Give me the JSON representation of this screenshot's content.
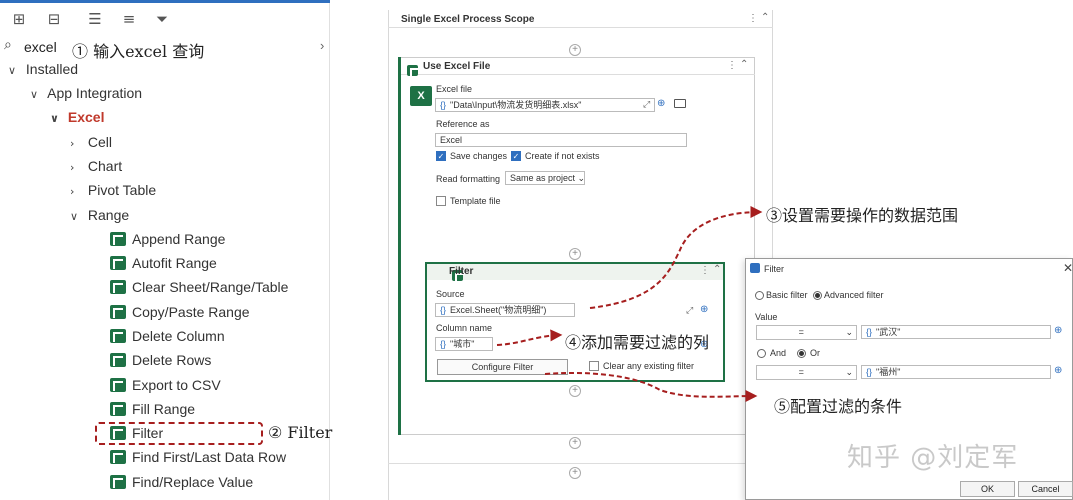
{
  "toolbar": {
    "icons": [
      "expand-all-icon",
      "collapse-all-icon",
      "sort-icon",
      "list-view-icon",
      "filter-icon"
    ]
  },
  "search": {
    "value": "excel",
    "close": "›"
  },
  "tree": {
    "installed": "Installed",
    "app_integration": "App Integration",
    "excel": "Excel",
    "cell": "Cell",
    "chart": "Chart",
    "pivot_table": "Pivot Table",
    "range": "Range",
    "range_items": [
      "Append Range",
      "Autofit Range",
      "Clear Sheet/Range/Table",
      "Copy/Paste Range",
      "Delete Column",
      "Delete Rows",
      "Export to CSV",
      "Fill Range",
      "Filter",
      "Find First/Last Data Row",
      "Find/Replace Value"
    ]
  },
  "annotations": {
    "a1": "① 输入excel 查询",
    "a2": "② Filter",
    "a3": "③设置需要操作的数据范围",
    "a4": "④添加需要过滤的列",
    "a5": "⑤配置过滤的条件"
  },
  "scope": {
    "title": "Single Excel Process Scope",
    "use_excel": {
      "title": "Use Excel File",
      "excel_file_label": "Excel file",
      "excel_file_value": "\"Data\\Input\\物流发货明细表.xlsx\"",
      "reference_label": "Reference as",
      "reference_value": "Excel",
      "save_changes": "Save changes",
      "create_if_not_exists": "Create if not exists",
      "read_formatting_label": "Read formatting",
      "read_formatting_value": "Same as project",
      "template_file": "Template file"
    },
    "filter": {
      "title": "Filter",
      "source_label": "Source",
      "source_value": "Excel.Sheet(\"物流明细\")",
      "column_label": "Column name",
      "column_value": "\"城市\"",
      "configure": "Configure Filter",
      "clear_existing": "Clear any existing filter"
    }
  },
  "dialog": {
    "title": "Filter",
    "basic": "Basic filter",
    "advanced": "Advanced filter",
    "value_label": "Value",
    "op1": "=",
    "val1": "\"武汉\"",
    "and": "And",
    "or": "Or",
    "op2": "=",
    "val2": "\"福州\"",
    "ok": "OK",
    "cancel": "Cancel"
  },
  "watermark": "知乎 @刘定军",
  "colors": {
    "excel_green": "#1e7145",
    "annotation_red": "#a61e1e",
    "accent_blue": "#2f6fbf"
  }
}
